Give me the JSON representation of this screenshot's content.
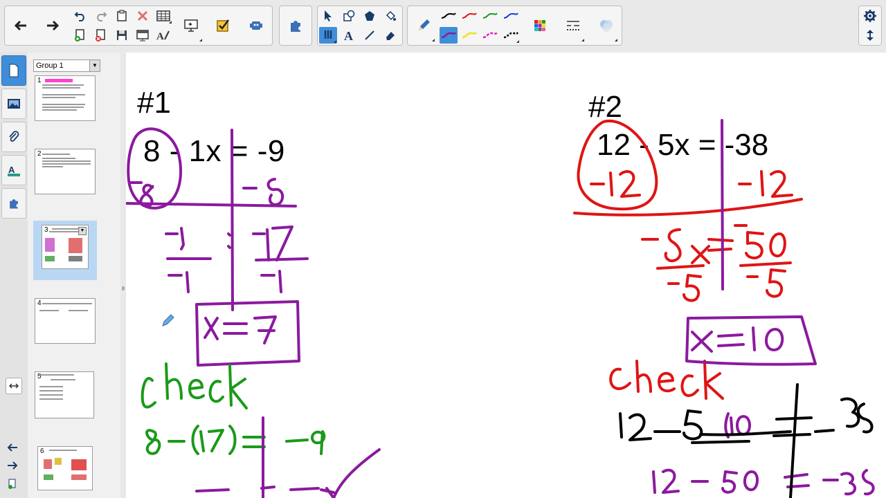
{
  "sorter": {
    "group_label": "Group 1",
    "pages": [
      {
        "num": "1",
        "selected": false
      },
      {
        "num": "2",
        "selected": false
      },
      {
        "num": "3",
        "selected": true
      },
      {
        "num": "4",
        "selected": false
      },
      {
        "num": "5",
        "selected": false
      },
      {
        "num": "6",
        "selected": false
      }
    ]
  },
  "canvas": {
    "problem1": {
      "label": "#1",
      "equation": "8 - 1x = -9"
    },
    "problem2": {
      "label": "#2",
      "equation": "12 - 5x = -38"
    }
  },
  "icons": {
    "back": "arrow-left-icon",
    "forward": "arrow-right-icon",
    "settings": "gear-icon",
    "expand": "arrows-updown-icon"
  },
  "colors": {
    "purple_ink": "#8b1a9e",
    "red_ink": "#e01414",
    "green_ink": "#1a9a1a",
    "black_ink": "#000000",
    "selection_blue": "#3f8ed9"
  }
}
